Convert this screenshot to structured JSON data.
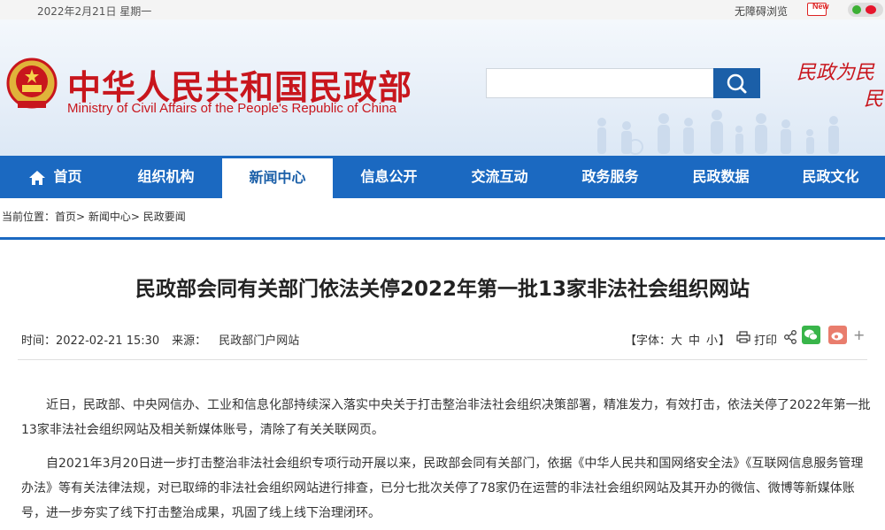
{
  "topbar": {
    "date": "2022年2月21日 星期一",
    "accessibility": "无障碍浏览",
    "new_badge": "New"
  },
  "header": {
    "title_cn": "中华人民共和国民政部",
    "title_en": "Ministry of Civil Affairs of the People's Republic of China",
    "search_placeholder": "",
    "slogan_line1": "民政为民",
    "slogan_line2": "民"
  },
  "nav": {
    "items": [
      {
        "label": "首页"
      },
      {
        "label": "组织机构"
      },
      {
        "label": "新闻中心"
      },
      {
        "label": "信息公开"
      },
      {
        "label": "交流互动"
      },
      {
        "label": "政务服务"
      },
      {
        "label": "民政数据"
      },
      {
        "label": "民政文化"
      }
    ],
    "active_index": 2
  },
  "breadcrumb": {
    "prefix": "当前位置：",
    "items": [
      "首页",
      "新闻中心",
      "民政要闻"
    ]
  },
  "article": {
    "title": "民政部会同有关部门依法关停2022年第一批13家非法社会组织网站",
    "time_label": "时间：",
    "time": "2022-02-21 15:30",
    "source_label": "来源：",
    "source": "民政部门户网站",
    "font_label": "【字体：",
    "font_large": "大",
    "font_medium": "中",
    "font_small": "小",
    "font_close": "】",
    "print": "打印",
    "paragraphs": [
      "近日，民政部、中央网信办、工业和信息化部持续深入落实中央关于打击整治非法社会组织决策部署，精准发力，有效打击，依法关停了2022年第一批13家非法社会组织网站及相关新媒体账号，清除了有关关联网页。",
      "自2021年3月20日进一步打击整治非法社会组织专项行动开展以来，民政部会同有关部门，依据《中华人民共和国网络安全法》《互联网信息服务管理办法》等有关法律法规，对已取缔的非法社会组织网站进行排查，已分七批次关停了78家仍在运营的非法社会组织网站及其开办的微信、微博等新媒体账号，进一步夯实了线下打击整治成果，巩固了线上线下治理闭环。"
    ]
  },
  "colors": {
    "brand_red": "#c8161d",
    "nav_blue": "#1b69c1",
    "search_blue": "#1b5fa8"
  }
}
